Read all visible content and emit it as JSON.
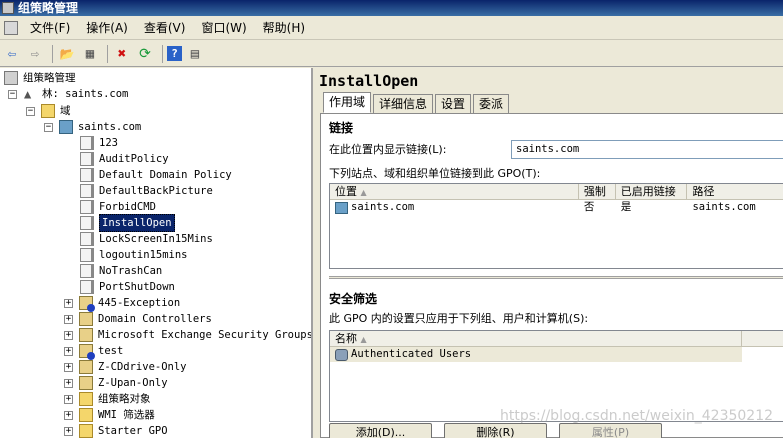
{
  "window": {
    "title": "组策略管理"
  },
  "menu": [
    "文件(F)",
    "操作(A)",
    "查看(V)",
    "窗口(W)",
    "帮助(H)"
  ],
  "toolbar": {
    "icons": [
      "back-arrow-icon",
      "forward-arrow-icon",
      "up-folder-icon",
      "show-hide-tree-icon",
      "delete-icon",
      "refresh-icon",
      "help-icon",
      "properties-icon"
    ],
    "glyphs": [
      "⇦",
      "⇨",
      "📂",
      "▦",
      "✖",
      "⟳",
      "?",
      "▤"
    ]
  },
  "tree": {
    "root": "组策略管理",
    "forest": "林: saints.com",
    "domains_folder": "域",
    "domain": "saints.com",
    "gpos": [
      "123",
      "AuditPolicy",
      "Default Domain Policy",
      "DefaultBackPicture",
      "ForbidCMD",
      "InstallOpen",
      "LockScreenIn15Mins",
      "logoutin15mins",
      "NoTrashCan",
      "PortShutDown"
    ],
    "selected": "InstallOpen",
    "ous": [
      "445-Exception",
      "Domain Controllers",
      "Microsoft Exchange Security Groups",
      "test",
      "Z-CDdrive-Only",
      "Z-Upan-Only",
      "组策略对象",
      "WMI 筛选器",
      "Starter GPO"
    ]
  },
  "detail": {
    "title": "InstallOpen",
    "tabs": [
      "作用域",
      "详细信息",
      "设置",
      "委派"
    ],
    "active_tab": "作用域",
    "links": {
      "title": "链接",
      "location_label": "在此位置内显示链接(L):",
      "location_value": "saints.com",
      "list_label": "下列站点、域和组织单位链接到此 GPO(T):",
      "columns": [
        "位置",
        "强制",
        "已启用链接",
        "路径"
      ],
      "rows": [
        {
          "location": "saints.com",
          "enforced": "否",
          "enabled": "是",
          "path": "saints.com"
        }
      ]
    },
    "security": {
      "title": "安全筛选",
      "label": "此 GPO 内的设置只应用于下列组、用户和计算机(S):",
      "column": "名称",
      "rows": [
        "Authenticated Users"
      ],
      "buttons": [
        "添加(D)...",
        "删除(R)",
        "属性(P)"
      ]
    }
  },
  "watermark": "https://blog.csdn.net/weixin_42350212"
}
